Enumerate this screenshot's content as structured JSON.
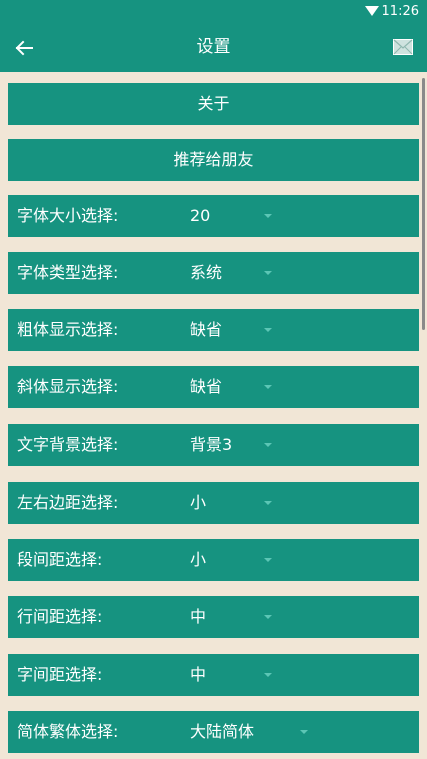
{
  "status_bar": {
    "time": "11:26"
  },
  "app_bar": {
    "title": "设置"
  },
  "buttons": {
    "about": "关于",
    "recommend": "推荐给朋友"
  },
  "settings": [
    {
      "label": "字体大小选择:",
      "value": "20"
    },
    {
      "label": "字体类型选择:",
      "value": "系统"
    },
    {
      "label": "粗体显示选择:",
      "value": "缺省"
    },
    {
      "label": "斜体显示选择:",
      "value": "缺省"
    },
    {
      "label": "文字背景选择:",
      "value": "背景3"
    },
    {
      "label": "左右边距选择:",
      "value": "小"
    },
    {
      "label": "段间距选择:",
      "value": "小"
    },
    {
      "label": "行间距选择:",
      "value": "中"
    },
    {
      "label": "字间距选择:",
      "value": "中"
    },
    {
      "label": "简体繁体选择:",
      "value": "大陆简体"
    }
  ],
  "colors": {
    "primary": "#169380",
    "background": "#f1e6d6",
    "caret": "#5cc6b5"
  }
}
